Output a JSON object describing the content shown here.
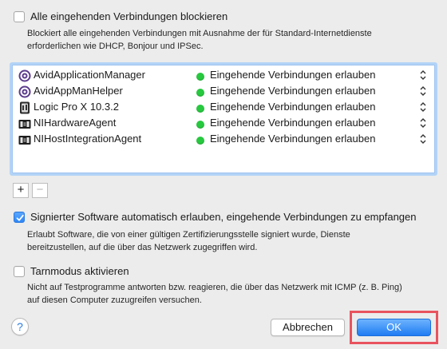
{
  "block_all": {
    "label": "Alle eingehenden Verbindungen blockieren",
    "checked": false,
    "description": "Blockiert alle eingehenden Verbindungen mit Ausnahme der für Standard-Internetdienste\nerforderlichen wie DHCP, Bonjour und IPSec."
  },
  "apps": [
    {
      "name": "AvidApplicationManager",
      "icon": "avid-icon",
      "status": "Eingehende Verbindungen erlauben",
      "status_color": "#27c93f"
    },
    {
      "name": "AvidAppManHelper",
      "icon": "avid-icon",
      "status": "Eingehende Verbindungen erlauben",
      "status_color": "#27c93f"
    },
    {
      "name": "Logic Pro X 10.3.2",
      "icon": "logic-pro-icon",
      "status": "Eingehende Verbindungen erlauben",
      "status_color": "#27c93f"
    },
    {
      "name": "NIHardwareAgent",
      "icon": "ni-agent-icon",
      "status": "Eingehende Verbindungen erlauben",
      "status_color": "#27c93f"
    },
    {
      "name": "NIHostIntegrationAgent",
      "icon": "ni-agent-icon",
      "status": "Eingehende Verbindungen erlauben",
      "status_color": "#27c93f"
    }
  ],
  "list_controls": {
    "add": "+",
    "remove": "−"
  },
  "signed_software": {
    "label": "Signierter Software automatisch erlauben, eingehende Verbindungen zu empfangen",
    "checked": true,
    "description": "Erlaubt Software, die von einer gültigen Zertifizierungsstelle signiert wurde, Dienste\nbereitzustellen, auf die über das Netzwerk zugegriffen wird."
  },
  "stealth_mode": {
    "label": "Tarnmodus aktivieren",
    "checked": false,
    "description": "Nicht auf Testprogramme antworten bzw. reagieren, die über das Netzwerk mit ICMP (z. B. Ping)\nauf diesen Computer zuzugreifen versuchen."
  },
  "footer": {
    "help": "?",
    "cancel_label": "Abbrechen",
    "ok_label": "OK"
  },
  "colors": {
    "accent": "#2f86f6",
    "highlight": "#e8535e",
    "status_allowed": "#27c93f"
  }
}
